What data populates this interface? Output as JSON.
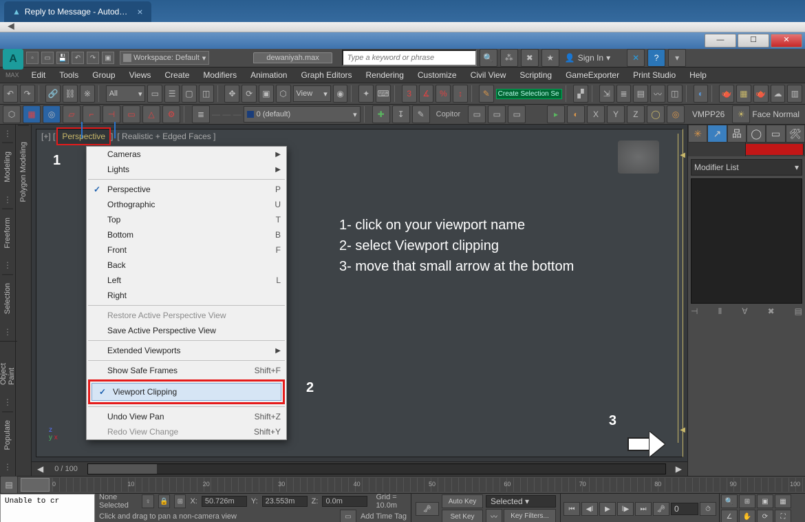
{
  "browser": {
    "tab_title": "Reply to Message - Autod…"
  },
  "win": {
    "min": "—",
    "max": "☐",
    "close": "✕"
  },
  "app_top": {
    "workspace_label": "Workspace: Default",
    "doc_name": "dewaniyah.max",
    "search_placeholder": "Type a keyword or phrase",
    "signin": "Sign In",
    "help_icon": "?"
  },
  "menu_bar": {
    "logo": "MAX",
    "items": [
      "Edit",
      "Tools",
      "Group",
      "Views",
      "Create",
      "Modifiers",
      "Animation",
      "Graph Editors",
      "Rendering",
      "Customize",
      "Civil View",
      "Scripting",
      "GameExporter",
      "Print Studio",
      "Help"
    ]
  },
  "toolbar1": {
    "filter_label": "All",
    "view_label": "View",
    "sel_set_label": "Create Selection Se"
  },
  "toolbar2": {
    "layer_label": "0 (default)",
    "copitor": "Copitor",
    "axes": [
      "X",
      "Y",
      "Z"
    ],
    "vmpp": "VMPP26",
    "face_normal": "Face Normal"
  },
  "left_tabs": [
    "Modeling",
    "Polygon Modeling",
    "Freeform",
    "Selection",
    "Object Paint",
    "Populate"
  ],
  "viewport": {
    "corner_left": "[+] [",
    "name": "Perspective",
    "corner_right": "]",
    "shading": "[ Realistic + Edged Faces ]"
  },
  "ctx": {
    "cameras": "Cameras",
    "lights": "Lights",
    "perspective": "Perspective",
    "perspective_k": "P",
    "orthographic": "Orthographic",
    "orthographic_k": "U",
    "top": "Top",
    "top_k": "T",
    "bottom": "Bottom",
    "bottom_k": "B",
    "front": "Front",
    "front_k": "F",
    "back": "Back",
    "left": "Left",
    "left_k": "L",
    "right": "Right",
    "restore": "Restore Active Perspective View",
    "save": "Save Active Perspective View",
    "extended": "Extended Viewports",
    "safeframes": "Show Safe Frames",
    "safeframes_k": "Shift+F",
    "clipping": "Viewport Clipping",
    "undo": "Undo View Pan",
    "undo_k": "Shift+Z",
    "redo": "Redo View Change",
    "redo_k": "Shift+Y"
  },
  "annotations": {
    "n1": "1",
    "n2": "2",
    "n3": "3",
    "line1": "1- click on your viewport name",
    "line2": "2- select Viewport clipping",
    "line3": "3- move that small arrow at the bottom"
  },
  "cmd_panel": {
    "modlist": "Modifier List"
  },
  "trackbar": {
    "frame": "0 / 100"
  },
  "ruler_ticks": [
    "0",
    "10",
    "20",
    "30",
    "40",
    "50",
    "60",
    "70",
    "80",
    "90",
    "100"
  ],
  "status": {
    "sel": "None Selected",
    "x": "50.726m",
    "y": "23.553m",
    "z": "0.0m",
    "xl": "X:",
    "yl": "Y:",
    "zl": "Z:",
    "grid": "Grid = 10.0m",
    "prompt": "Click and drag to pan a non-camera view",
    "timetag": "Add Time Tag",
    "autokey": "Auto Key",
    "setkey": "Set Key",
    "selected": "Selected",
    "keyfilters": "Key Filters...",
    "frame_num": "0",
    "maxscript": "Unable to cr"
  }
}
